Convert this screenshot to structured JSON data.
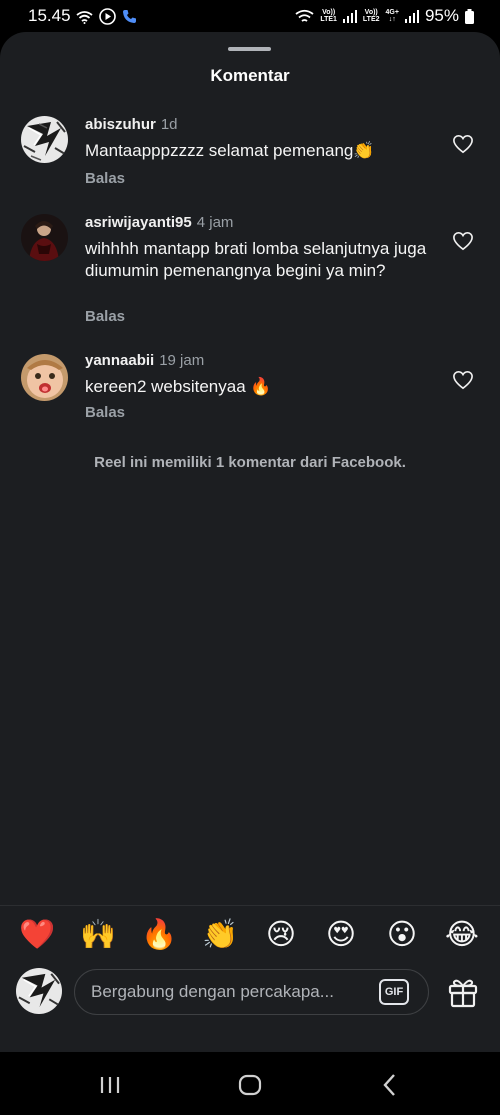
{
  "status_bar": {
    "time": "15.45",
    "sim1_line1": "Vo))",
    "sim1_line2": "LTE1",
    "sim2_line1": "Vo))",
    "sim2_line2": "LTE2",
    "data_type": "4G+",
    "battery": "95%"
  },
  "sheet": {
    "title": "Komentar"
  },
  "comments": [
    {
      "username": "abiszuhur",
      "time": "1d",
      "text": "Mantaapppzzzz selamat pemenang👏",
      "reply_label": "Balas",
      "avatar_icon": "sketch-avatar"
    },
    {
      "username": "asriwijayanti95",
      "time": "4 jam",
      "text": "wihhhh mantapp brati lomba selanjutnya juga diumumin pemenangnya begini ya min?",
      "reply_label": "Balas",
      "avatar_icon": "person-photo-avatar"
    },
    {
      "username": "yannaabii",
      "time": "19 jam",
      "text": "kereen2 websitenyaa 🔥",
      "reply_label": "Balas",
      "avatar_icon": "child-photo-avatar"
    }
  ],
  "fb_note": "Reel ini memiliki 1 komentar dari Facebook.",
  "reactions": [
    "❤️",
    "🙌",
    "🔥",
    "👏",
    "😢",
    "😍",
    "😮",
    "😂"
  ],
  "composer": {
    "placeholder": "Bergabung dengan percakapa...",
    "gif_label": "GIF"
  },
  "colors": {
    "sheet_bg": "#1c1e21",
    "muted_text": "#9aa0a6",
    "status_bar_bg": "#000000"
  }
}
